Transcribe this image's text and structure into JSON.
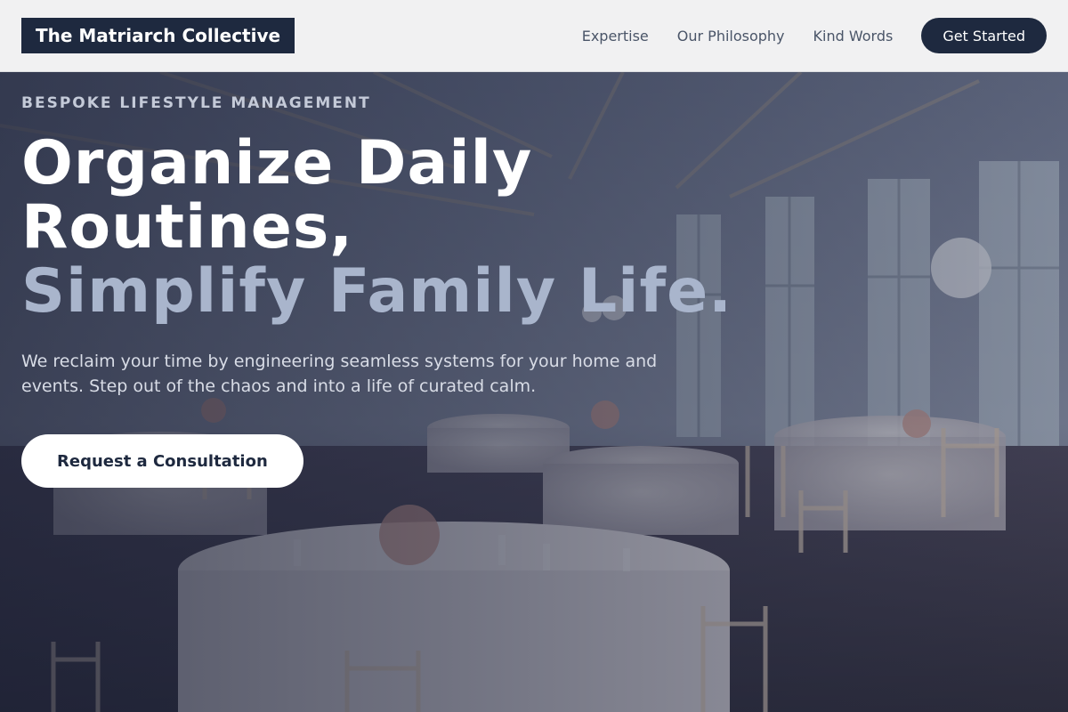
{
  "header": {
    "brand": "The Matriarch Collective",
    "nav": [
      {
        "label": "Expertise"
      },
      {
        "label": "Our Philosophy"
      },
      {
        "label": "Kind Words"
      }
    ],
    "cta_label": "Get Started"
  },
  "hero": {
    "eyebrow": "BESPOKE LIFESTYLE MANAGEMENT",
    "headline_line1": "Organize Daily Routines,",
    "headline_line2": "Simplify Family Life.",
    "subtext": "We reclaim your time by engineering seamless systems for your home and events. Step out of the chaos and into a life of curated calm.",
    "cta_label": "Request a Consultation"
  },
  "colors": {
    "navy": "#1e293f",
    "header_bg": "#f1f1f2",
    "headline_accent": "#a9b5cc",
    "white": "#ffffff"
  }
}
